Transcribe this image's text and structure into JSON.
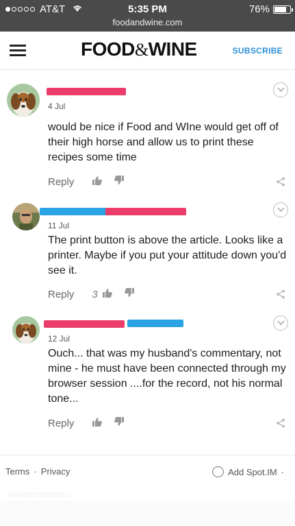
{
  "status_bar": {
    "carrier": "AT&T",
    "time": "5:35 PM",
    "battery_percent": "76%",
    "battery_level": 0.76,
    "url": "foodandwine.com"
  },
  "header": {
    "logo_left": "FOOD",
    "logo_amp": "&",
    "logo_right": "WINE",
    "subscribe_label": "SUBSCRIBE"
  },
  "comments": [
    {
      "date": "4 Jul",
      "text": "would be nice if Food and WIne would get off of their high horse and allow us to print these recipes some time",
      "reply_label": "Reply",
      "like_count": ""
    },
    {
      "date": "11 Jul",
      "text": "The print button is above the article. Looks like a printer. Maybe if you put your attitude down you'd see it.",
      "reply_label": "Reply",
      "like_count": "3"
    },
    {
      "date": "12 Jul",
      "text": "Ouch... that was my husband's commentary, not mine - he must have been connected through my browser session ....for the record, not his normal tone...",
      "reply_label": "Reply",
      "like_count": ""
    }
  ],
  "footer": {
    "terms": "Terms",
    "separator": "·",
    "privacy": "Privacy",
    "add_spotim": "Add Spot.IM",
    "add_separator": "·",
    "ad_label": "ADVERTISEMENT"
  },
  "colors": {
    "redaction_pink": "#ea3d6c",
    "redaction_blue": "#2ba4e6",
    "subscribe_blue": "#2a8fd6"
  },
  "icons": [
    "wifi-icon",
    "battery-icon",
    "hamburger-menu-icon",
    "chevron-down-icon",
    "thumbs-up-icon",
    "thumbs-down-icon",
    "share-icon",
    "speech-bubble-icon"
  ]
}
